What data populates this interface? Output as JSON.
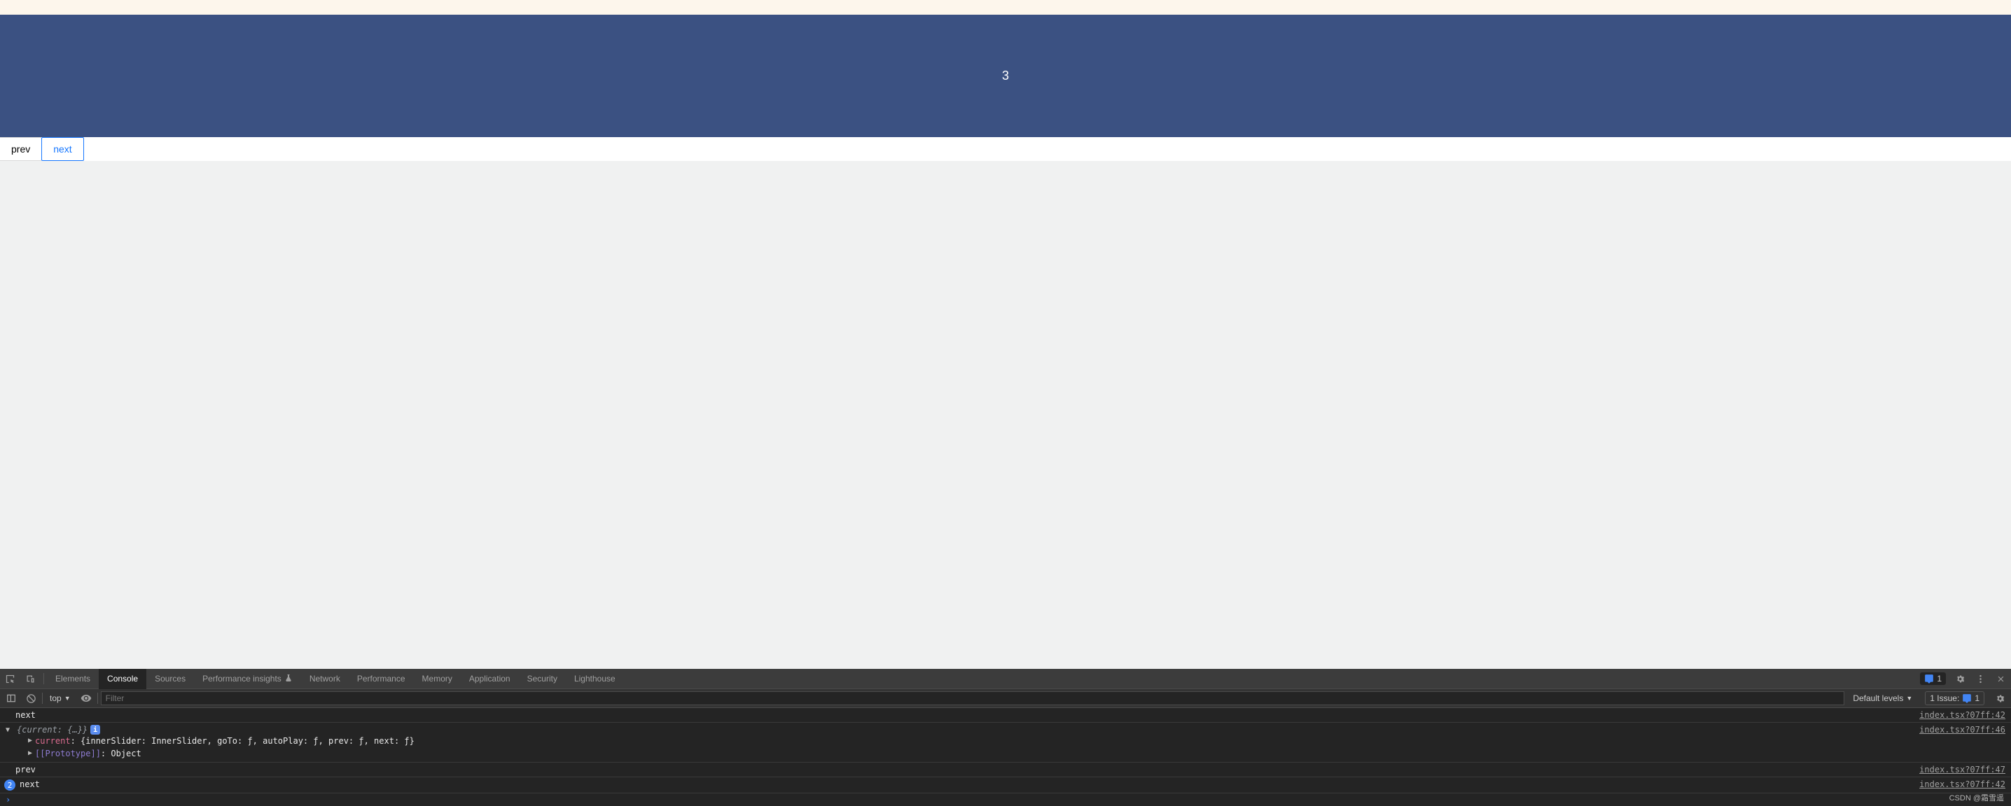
{
  "carousel": {
    "value": "3"
  },
  "buttons": {
    "prev": "prev",
    "next": "next"
  },
  "devtools": {
    "tabs": [
      "Elements",
      "Console",
      "Sources",
      "Performance insights",
      "Network",
      "Performance",
      "Memory",
      "Application",
      "Security",
      "Lighthouse"
    ],
    "activeTab": "Console",
    "issuesBadge": "1",
    "toolbar": {
      "context": "top",
      "filterPlaceholder": "Filter",
      "levels": "Default levels",
      "issuesLabel": "1 Issue:",
      "issuesCount": "1"
    },
    "rows": [
      {
        "type": "log",
        "text": "next",
        "src": "index.tsx?07ff:42"
      },
      {
        "type": "object",
        "summary": "{current: {…}}",
        "src": "index.tsx?07ff:46",
        "expanded": {
          "currentKey": "current",
          "currentValue": "{innerSlider: InnerSlider, goTo: ƒ, autoPlay: ƒ, prev: ƒ, next: ƒ}",
          "protoKey": "[[Prototype]]",
          "protoValue": "Object"
        }
      },
      {
        "type": "log",
        "text": "prev",
        "src": "index.tsx?07ff:47"
      },
      {
        "type": "count",
        "count": "2",
        "text": "next",
        "src": "index.tsx?07ff:42"
      }
    ]
  },
  "watermark": "CSDN @霜雪遥"
}
